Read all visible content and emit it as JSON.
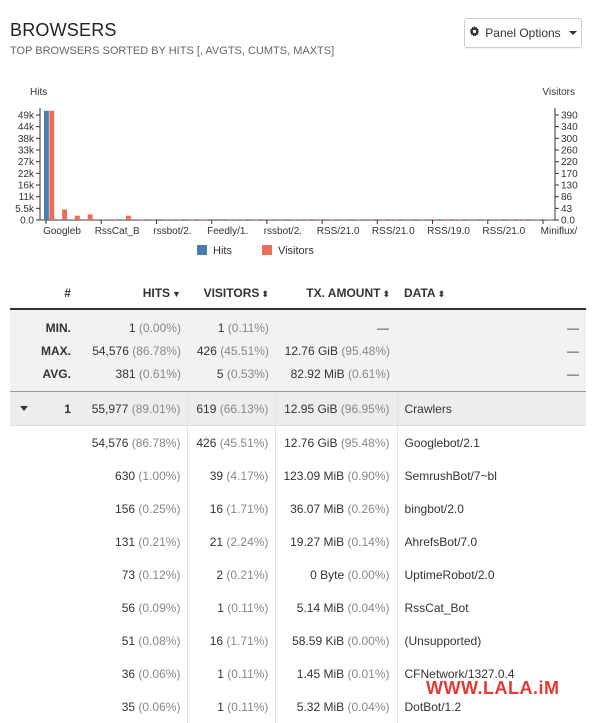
{
  "panel": {
    "title": "BROWSERS",
    "subtitle": "TOP BROWSERS SORTED BY HITS [, AVGTS, CUMTS, MAXTS]",
    "options_label": "Panel Options"
  },
  "icons": {
    "options": "gear-icon",
    "dropdown": "caret-down-icon",
    "sort": "sort-icon",
    "expand": "caret-down-icon"
  },
  "colors": {
    "hits": "#447fb4",
    "visitors": "#ee6d57"
  },
  "chart_data": {
    "type": "bar",
    "left_label": "Hits",
    "right_label": "Visitors",
    "left_ticks": [
      "49k",
      "44k",
      "38k",
      "33k",
      "27k",
      "22k",
      "16k",
      "11k",
      "5.5k",
      "0.0"
    ],
    "right_ticks": [
      "390",
      "340",
      "300",
      "260",
      "220",
      "170",
      "130",
      "86",
      "43",
      "0.0"
    ],
    "x_labels": [
      "Googleb",
      "RssCat_B",
      "rssbot/2.",
      "Feedly/1.",
      "rssbot/2.",
      "RSS/21.0",
      "RSS/21.0",
      "RSS/19.0",
      "RSS/21.0",
      "Miniflux/"
    ],
    "ylim_hits": [
      0,
      49000
    ],
    "ylim_visitors": [
      0,
      390
    ],
    "series": [
      {
        "name": "Hits",
        "values": [
          54576,
          56,
          30,
          14,
          10,
          6,
          5,
          4,
          3,
          3,
          3,
          2,
          2,
          2,
          1,
          1,
          1,
          1,
          1,
          1,
          1,
          1,
          1,
          1,
          1,
          1,
          1,
          1,
          1,
          1,
          1,
          1,
          1,
          1,
          1,
          1,
          1,
          1,
          1,
          1
        ]
      },
      {
        "name": "Visitors",
        "values": [
          426,
          39,
          16,
          21,
          2,
          1,
          16,
          1,
          1,
          2,
          1,
          1,
          1,
          3,
          1,
          1,
          1,
          1,
          1,
          1,
          1,
          1,
          1,
          1,
          1,
          1,
          1,
          1,
          1,
          1,
          1,
          1,
          1,
          1,
          1,
          1,
          1,
          1,
          1,
          1
        ]
      }
    ]
  },
  "legend": {
    "hits": "Hits",
    "visitors": "Visitors"
  },
  "table": {
    "headers": {
      "num": "#",
      "hits": "HITS",
      "visitors": "VISITORS",
      "tx": "TX. AMOUNT",
      "data": "DATA"
    },
    "meta": [
      {
        "label": "MIN.",
        "hits": "1",
        "hits_pct": "(0.00%)",
        "visitors": "1",
        "visitors_pct": "(0.11%)",
        "tx": "—",
        "tx_pct": "",
        "data": "—"
      },
      {
        "label": "MAX.",
        "hits": "54,576",
        "hits_pct": "(86.78%)",
        "visitors": "426",
        "visitors_pct": "(45.51%)",
        "tx": "12.76 GiB",
        "tx_pct": "(95.48%)",
        "data": "—"
      },
      {
        "label": "AVG.",
        "hits": "381",
        "hits_pct": "(0.61%)",
        "visitors": "5",
        "visitors_pct": "(0.53%)",
        "tx": "82.92 MiB",
        "tx_pct": "(0.61%)",
        "data": "—"
      }
    ],
    "group": {
      "num": "1",
      "hits": "55,977",
      "hits_pct": "(89.01%)",
      "visitors": "619",
      "visitors_pct": "(66.13%)",
      "tx": "12.95 GiB",
      "tx_pct": "(96.95%)",
      "data": "Crawlers"
    },
    "rows": [
      {
        "hits": "54,576",
        "hits_pct": "(86.78%)",
        "visitors": "426",
        "visitors_pct": "(45.51%)",
        "tx": "12.76 GiB",
        "tx_pct": "(95.48%)",
        "data": "Googlebot/2.1"
      },
      {
        "hits": "630",
        "hits_pct": "(1.00%)",
        "visitors": "39",
        "visitors_pct": "(4.17%)",
        "tx": "123.09 MiB",
        "tx_pct": "(0.90%)",
        "data": "SemrushBot/7~bl"
      },
      {
        "hits": "156",
        "hits_pct": "(0.25%)",
        "visitors": "16",
        "visitors_pct": "(1.71%)",
        "tx": "36.07 MiB",
        "tx_pct": "(0.26%)",
        "data": "bingbot/2.0"
      },
      {
        "hits": "131",
        "hits_pct": "(0.21%)",
        "visitors": "21",
        "visitors_pct": "(2.24%)",
        "tx": "19.27 MiB",
        "tx_pct": "(0.14%)",
        "data": "AhrefsBot/7.0"
      },
      {
        "hits": "73",
        "hits_pct": "(0.12%)",
        "visitors": "2",
        "visitors_pct": "(0.21%)",
        "tx": "0 Byte",
        "tx_pct": "(0.00%)",
        "data": "UptimeRobot/2.0"
      },
      {
        "hits": "56",
        "hits_pct": "(0.09%)",
        "visitors": "1",
        "visitors_pct": "(0.11%)",
        "tx": "5.14 MiB",
        "tx_pct": "(0.04%)",
        "data": "RssCat_Bot"
      },
      {
        "hits": "51",
        "hits_pct": "(0.08%)",
        "visitors": "16",
        "visitors_pct": "(1.71%)",
        "tx": "58.59 KiB",
        "tx_pct": "(0.00%)",
        "data": "(Unsupported)"
      },
      {
        "hits": "36",
        "hits_pct": "(0.06%)",
        "visitors": "1",
        "visitors_pct": "(0.11%)",
        "tx": "1.45 MiB",
        "tx_pct": "(0.01%)",
        "data": "CFNetwork/1327.0.4"
      },
      {
        "hits": "35",
        "hits_pct": "(0.06%)",
        "visitors": "1",
        "visitors_pct": "(0.11%)",
        "tx": "5.32 MiB",
        "tx_pct": "(0.04%)",
        "data": "DotBot/1.2"
      }
    ]
  },
  "watermark": "WWW.LALA.iM"
}
